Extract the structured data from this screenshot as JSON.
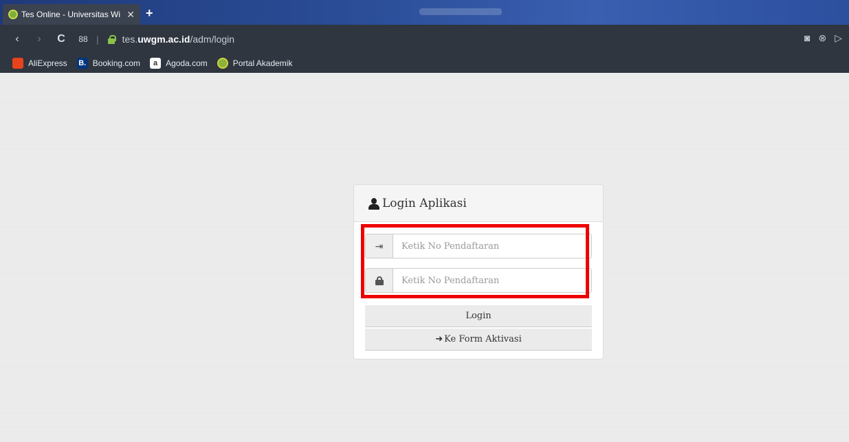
{
  "browser": {
    "tab_title": "Tes Online - Universitas Wi",
    "tab_close": "✕",
    "new_tab": "+",
    "url_prefix": "tes.",
    "url_domain": "uwgm.ac.id",
    "url_path": "/adm/login",
    "nav": {
      "back": "‹",
      "forward": "›",
      "reload": "C",
      "tiles": "88",
      "divider": "|"
    },
    "right_controls": {
      "snapshot": "◙",
      "extension": "⊗",
      "send": "▷"
    }
  },
  "bookmarks": [
    {
      "label": "AliExpress",
      "icon": "aliexpress-icon",
      "glyph": ""
    },
    {
      "label": "Booking.com",
      "icon": "booking-icon",
      "glyph": "B."
    },
    {
      "label": "Agoda.com",
      "icon": "agoda-icon",
      "glyph": "a"
    },
    {
      "label": "Portal Akademik",
      "icon": "portal-icon",
      "glyph": ""
    }
  ],
  "login": {
    "title": "Login Aplikasi",
    "username_placeholder": "Ketik No Pendaftaran",
    "username_icon_glyph": "⇥",
    "password_placeholder": "Ketik No Pendaftaran",
    "login_button": "Login",
    "activation_arrow": "➜",
    "activation_button": "Ke Form Aktivasi"
  },
  "colors": {
    "highlight": "#ee0000",
    "chrome_bg": "#2f3640",
    "page_bg": "#ececec"
  }
}
